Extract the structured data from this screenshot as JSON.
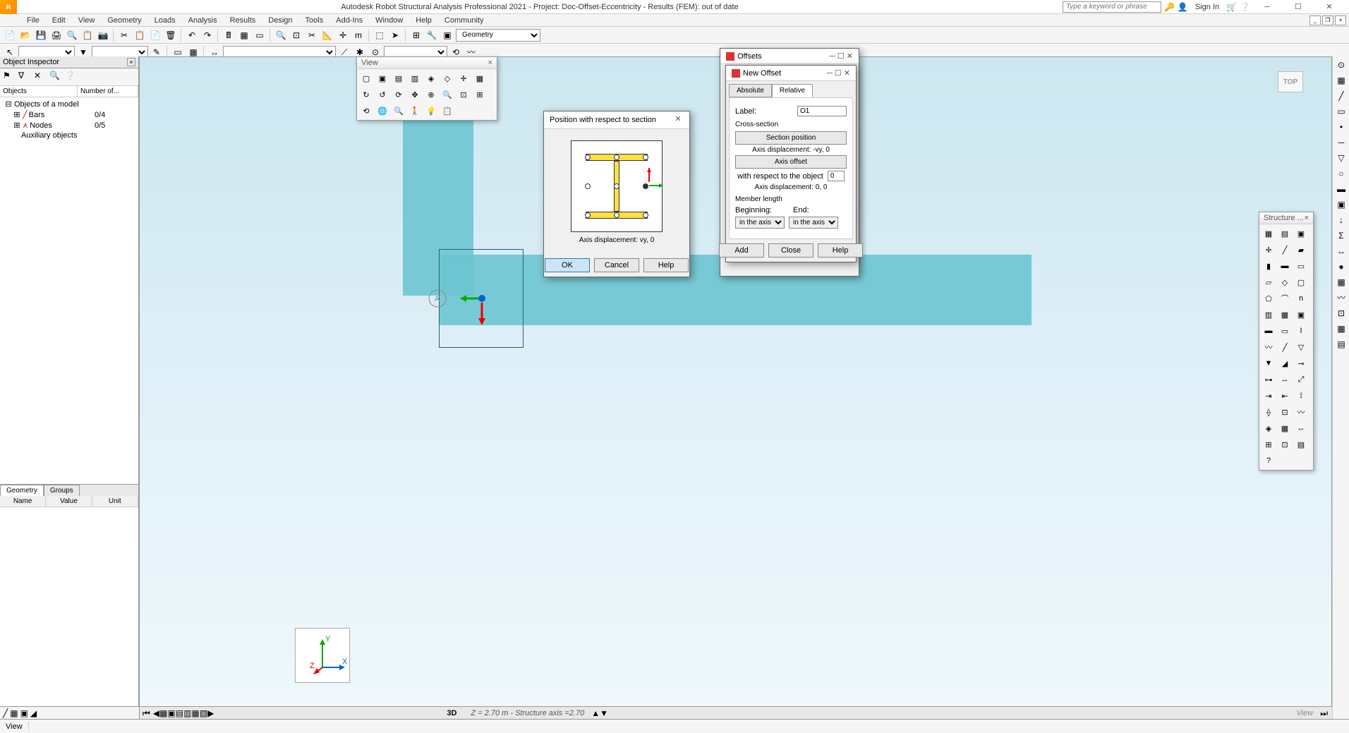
{
  "title": "Autodesk Robot Structural Analysis Professional 2021 - Project: Doc-Offset-Eccentricity - Results (FEM): out of date",
  "search_placeholder": "Type a keyword or phrase",
  "signin": "Sign In",
  "menu": [
    "File",
    "Edit",
    "View",
    "Geometry",
    "Loads",
    "Analysis",
    "Results",
    "Design",
    "Tools",
    "Add-Ins",
    "Window",
    "Help",
    "Community"
  ],
  "combo_geometry": "Geometry",
  "inspector": {
    "title": "Object Inspector",
    "cols": [
      "Objects",
      "Number of..."
    ],
    "root": "Objects of a model",
    "items": [
      {
        "label": "Bars",
        "count": "0/4"
      },
      {
        "label": "Nodes",
        "count": "0/5"
      },
      {
        "label": "Auxiliary objects",
        "count": ""
      }
    ],
    "tabs": [
      "Geometry",
      "Groups"
    ],
    "prop_cols": [
      "Name",
      "Value",
      "Unit"
    ]
  },
  "float_view_title": "View",
  "top_badge": "TOP",
  "pos_dialog": {
    "title": "Position with respect to section",
    "axis_disp": "Axis displacement:  vy, 0",
    "ok": "OK",
    "cancel": "Cancel",
    "help": "Help"
  },
  "offsets_dialog": {
    "title": "Offsets"
  },
  "newoffset_dialog": {
    "title": "New Offset",
    "tabs": [
      "Absolute",
      "Relative"
    ],
    "active_tab": 1,
    "label_lbl": "Label:",
    "label_val": "O1",
    "cross_section": "Cross-section",
    "section_position": "Section position",
    "axis_disp1": "Axis displacement:  -vy, 0",
    "axis_offset": "Axis offset",
    "wrt_object": "with respect to the object",
    "wrt_val": "0",
    "axis_disp2": "Axis displacement:  0, 0",
    "member_length": "Member length",
    "beginning": "Beginning:",
    "end": "End:",
    "combo_val": "in the axis",
    "add": "Add",
    "close": "Close",
    "help": "Help"
  },
  "struct_title": "Structure ...",
  "bottom": {
    "view3d": "3D",
    "coord": "Z = 2.70 m - Structure axis =2.70",
    "right": "View"
  },
  "status": "View"
}
